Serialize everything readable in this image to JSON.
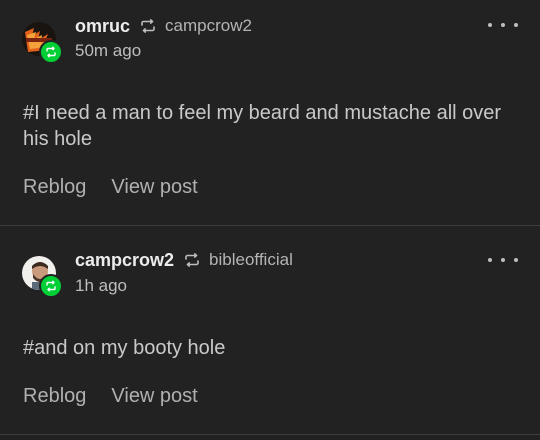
{
  "colors": {
    "background": "#222222",
    "divider": "#3d3d3d",
    "reblog_badge": "#00cf35",
    "username": "#ececec",
    "muted": "#b4b4b4"
  },
  "posts": [
    {
      "username": "omruc",
      "reblog_icon": "reblog-icon",
      "reblogged_from": "campcrow2",
      "timestamp": "50m ago",
      "body": "#I need a man to feel my beard and mustache all over his hole",
      "actions": {
        "reblog": "Reblog",
        "view_post": "View post"
      },
      "more_icon": "ellipsis-icon"
    },
    {
      "username": "campcrow2",
      "reblog_icon": "reblog-icon",
      "reblogged_from": "bibleofficial",
      "timestamp": "1h ago",
      "body": "#and on my booty hole",
      "actions": {
        "reblog": "Reblog",
        "view_post": "View post"
      },
      "more_icon": "ellipsis-icon"
    }
  ]
}
